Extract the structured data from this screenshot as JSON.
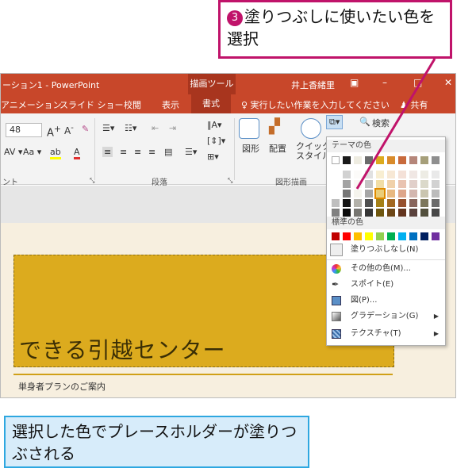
{
  "callout_top": {
    "step": "3",
    "text": "塗りつぶしに使いたい色を選択"
  },
  "callout_bottom": {
    "text": "選択した色でプレースホルダーが塗りつぶされる"
  },
  "titlebar": {
    "title": "ーション1 - PowerPoint",
    "context_tab": "描画ツール",
    "user": "井上香緒里",
    "restore_icon": "restore-icon",
    "minimize": "–",
    "maximize": "□",
    "close": "✕"
  },
  "tabs": [
    "アニメーション",
    "スライド ショー",
    "校閲",
    "表示",
    "書式"
  ],
  "tellme": "♀ 実行したい作業を入力してください",
  "share": "共有",
  "ribbon": {
    "font_size": "48",
    "group_font": "ント",
    "group_paragraph": "段落",
    "group_drawing": "図形描画",
    "shapes_label": "図形",
    "arrange_label": "配置",
    "quickstyle_label": "クイック\nスタイル",
    "search_label": "検索"
  },
  "dropdown": {
    "theme_header": "テーマの色",
    "standard_header": "標準の色",
    "no_fill": "塗りつぶしなし(N)",
    "more_colors": "その他の色(M)...",
    "eyedropper": "スポイト(E)",
    "picture": "図(P)...",
    "gradient": "グラデーション(G)",
    "texture": "テクスチャ(T)"
  },
  "slide": {
    "title": "できる引越センター",
    "subtitle": "単身者プランのご案内"
  },
  "colors": {
    "accent": "#c8472a",
    "highlight": "#c0136a",
    "fill": "#dcab1e"
  },
  "theme_colors": [
    "#ffffff",
    "#1a1a1a",
    "#eeece1",
    "#6b6b6b",
    "#dcab1e",
    "#d98b2b",
    "#c86a3c",
    "#b5867a",
    "#a69f7a",
    "#8f8f8f"
  ],
  "standard_colors": [
    "#c00000",
    "#ff0000",
    "#ffc000",
    "#ffff00",
    "#92d050",
    "#00b050",
    "#00b0f0",
    "#0070c0",
    "#002060",
    "#7030a0"
  ]
}
